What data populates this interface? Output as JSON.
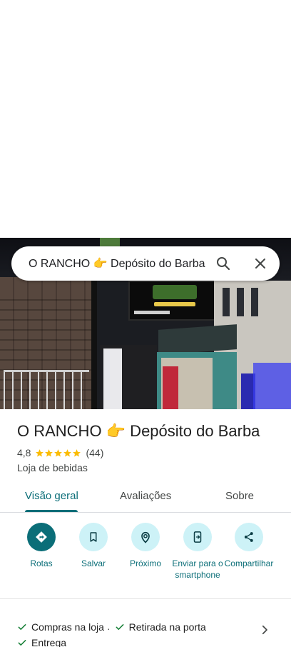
{
  "search": {
    "query": "O RANCHO 👉 Depósito do Barba"
  },
  "place": {
    "name": "O RANCHO 👉 Depósito do Barba",
    "rating": "4,8",
    "stars": 5,
    "review_count": "(44)",
    "category": "Loja de bebidas"
  },
  "tabs": [
    {
      "label": "Visão geral"
    },
    {
      "label": "Avaliações"
    },
    {
      "label": "Sobre"
    }
  ],
  "actions": [
    {
      "label": "Rotas",
      "icon": "directions-icon"
    },
    {
      "label": "Salvar",
      "icon": "bookmark-icon"
    },
    {
      "label": "Próximo",
      "icon": "nearby-icon"
    },
    {
      "label": "Enviar para o smartphone",
      "icon": "send-to-phone-icon"
    },
    {
      "label": "Compartilhar",
      "icon": "share-icon"
    }
  ],
  "features": [
    {
      "label": "Compras na loja"
    },
    {
      "label": "Retirada na porta"
    },
    {
      "label": "Entrega"
    }
  ],
  "features_separator": "·",
  "colors": {
    "accent": "#0b6e78",
    "action_bg": "#cdf2f7",
    "star": "#fbbc04",
    "check": "#188038"
  }
}
